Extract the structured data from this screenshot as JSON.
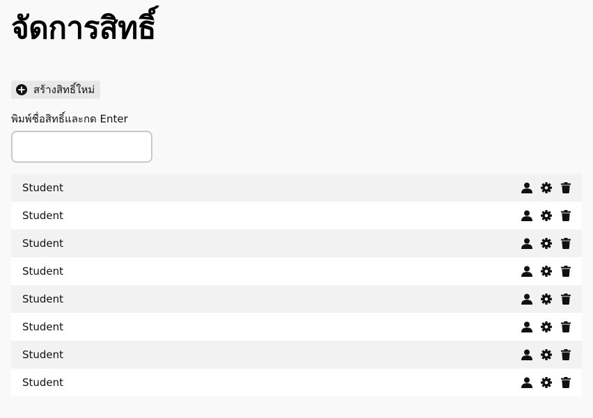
{
  "page": {
    "title": "จัดการสิทธิ์"
  },
  "create_button": {
    "label": "สร้างสิทธิ์ใหม่",
    "icon": "plus-circle-icon"
  },
  "name_field": {
    "label": "พิมพ์ชื่อสิทธิ์และกด Enter",
    "value": "",
    "placeholder": ""
  },
  "roles": [
    {
      "name": "Student"
    },
    {
      "name": "Student"
    },
    {
      "name": "Student"
    },
    {
      "name": "Student"
    },
    {
      "name": "Student"
    },
    {
      "name": "Student"
    },
    {
      "name": "Student"
    },
    {
      "name": "Student"
    }
  ],
  "row_actions": [
    "user-icon",
    "gear-icon",
    "trash-icon"
  ]
}
